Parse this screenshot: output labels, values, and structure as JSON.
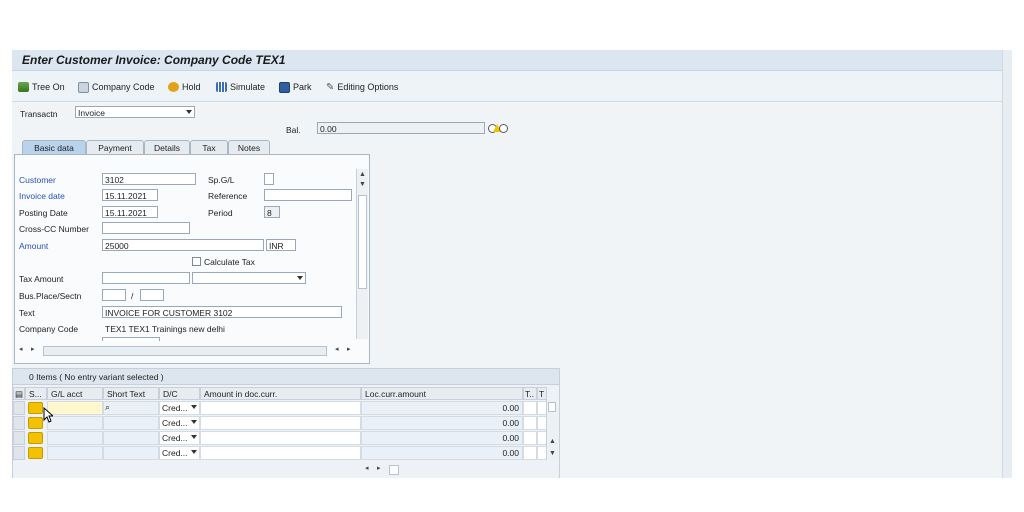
{
  "window": {
    "title": "Enter Customer Invoice: Company Code TEX1"
  },
  "toolbar": {
    "tree_on": "Tree On",
    "company_code": "Company Code",
    "hold": "Hold",
    "simulate": "Simulate",
    "park": "Park",
    "editing_options": "Editing Options"
  },
  "header": {
    "transaction_label": "Transactn",
    "transaction_value": "Invoice",
    "balance_label": "Bal.",
    "balance_value": "0.00"
  },
  "tabs": [
    "Basic data",
    "Payment",
    "Details",
    "Tax",
    "Notes"
  ],
  "basic_data": {
    "customer_label": "Customer",
    "customer_value": "3102",
    "spgl_label": "Sp.G/L",
    "spgl_value": "",
    "invoice_date_label": "Invoice date",
    "invoice_date_value": "15.11.2021",
    "reference_label": "Reference",
    "reference_value": "",
    "posting_date_label": "Posting Date",
    "posting_date_value": "15.11.2021",
    "period_label": "Period",
    "period_value": "8",
    "cross_cc_label": "Cross-CC Number",
    "cross_cc_value": "",
    "amount_label": "Amount",
    "amount_value": "25000",
    "currency_value": "INR",
    "calculate_tax_label": "Calculate Tax",
    "tax_amount_label": "Tax Amount",
    "tax_amount_value": "",
    "bus_place_label": "Bus.Place/Sectn",
    "bus_place_sep": "/",
    "text_label": "Text",
    "text_value": "INVOICE FOR CUSTOMER 3102",
    "company_code_label": "Company Code",
    "company_code_value": "TEX1  TEX1  Trainings new delhi"
  },
  "items": {
    "title": "0 Items ( No entry variant selected )",
    "columns": {
      "status": "S...",
      "gl_acct": "G/L acct",
      "short_text": "Short Text",
      "dc": "D/C",
      "amount_doc": "Amount in doc.curr.",
      "loc_amount": "Loc.curr.amount",
      "t1": "T..",
      "t2": "T"
    },
    "rows": [
      {
        "dc": "Cred...",
        "loc_amount": "0.00"
      },
      {
        "dc": "Cred...",
        "loc_amount": "0.00"
      },
      {
        "dc": "Cred...",
        "loc_amount": "0.00"
      },
      {
        "dc": "Cred...",
        "loc_amount": "0.00"
      }
    ]
  },
  "colors": {
    "title_bar": "#dbe6f1",
    "active_tab": "#b9d3ec",
    "required_label": "#2a4fb5",
    "status_marker": "#f2c200"
  }
}
